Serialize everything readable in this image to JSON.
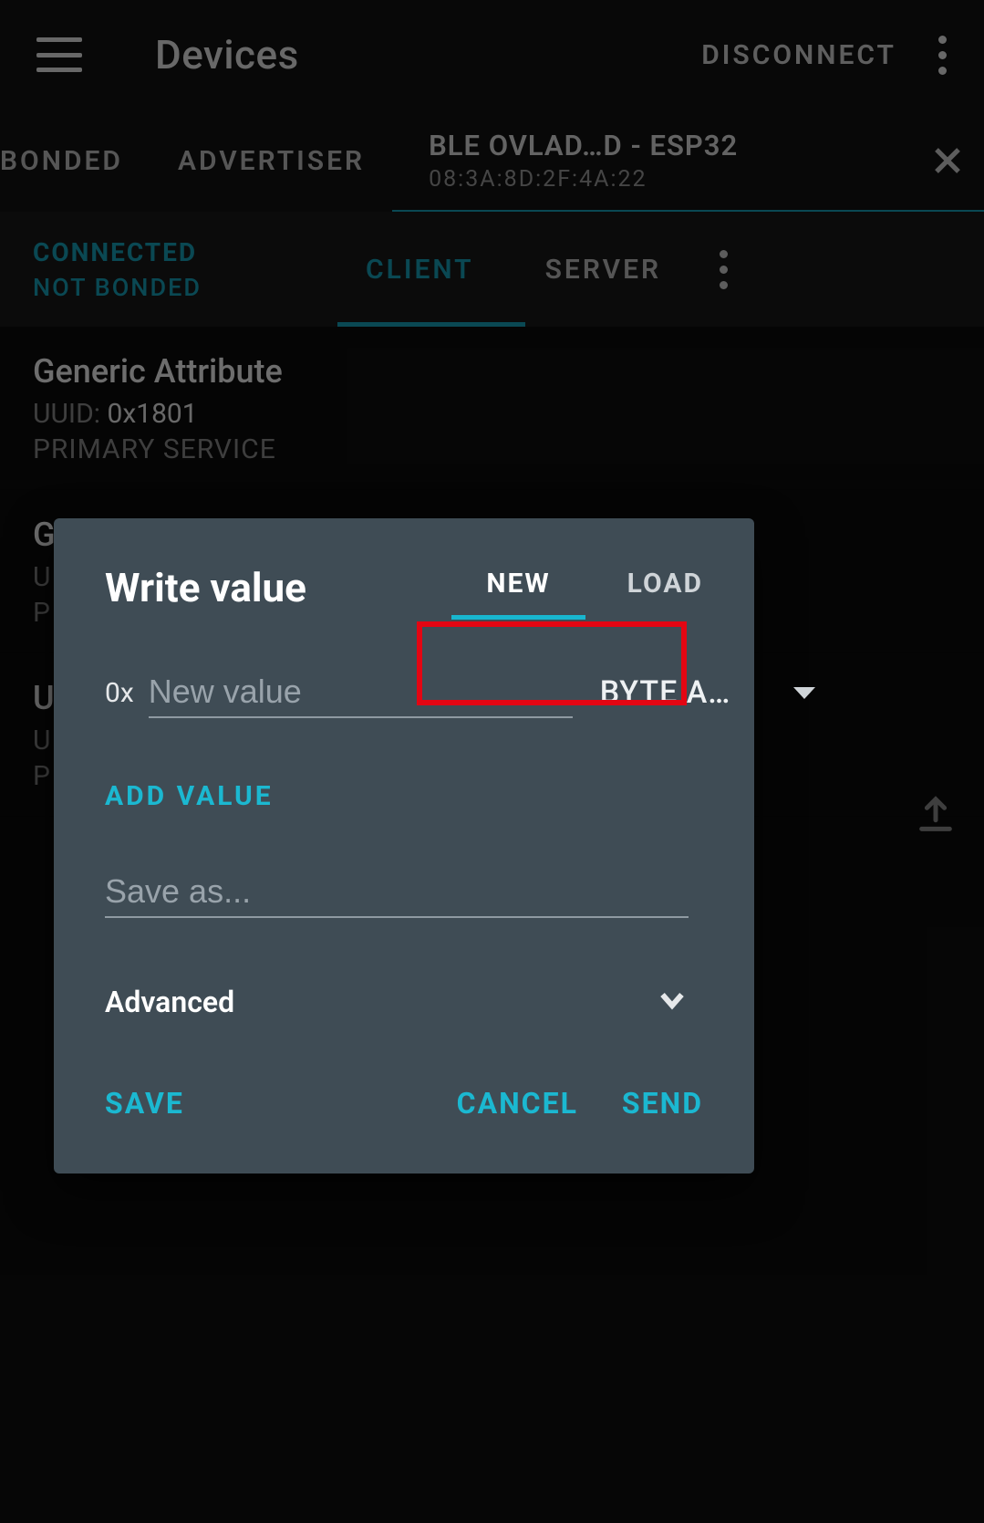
{
  "colors": {
    "accent": "#18b6cf",
    "dialog_bg": "#3f4c55",
    "highlight_border": "#e30613"
  },
  "topbar": {
    "title": "Devices",
    "disconnect_label": "DISCONNECT"
  },
  "tabs": {
    "bonded_label": "BONDED",
    "advertiser_label": "ADVERTISER",
    "device_name": "BLE OVLAD…D - ESP32",
    "device_addr": "08:3A:8D:2F:4A:22"
  },
  "status": {
    "connected_label": "CONNECTED",
    "bonded_label": "NOT BONDED",
    "client_label": "CLIENT",
    "server_label": "SERVER"
  },
  "services": [
    {
      "name": "Generic Attribute",
      "uuid_label": "UUID: ",
      "uuid_value": "0x1801",
      "type": "PRIMARY SERVICE"
    },
    {
      "name": "Generic Access",
      "uuid_label": "U",
      "uuid_value": "",
      "type": "P"
    },
    {
      "name": "U",
      "uuid_label": "U",
      "uuid_value": "",
      "type": "P"
    }
  ],
  "dialog": {
    "title": "Write value",
    "tab_new": "NEW",
    "tab_load": "LOAD",
    "prefix": "0x",
    "value_placeholder": "New value",
    "type_selected": "BYTE A…",
    "add_value_label": "ADD VALUE",
    "save_as_placeholder": "Save as...",
    "advanced_label": "Advanced",
    "save_label": "SAVE",
    "cancel_label": "CANCEL",
    "send_label": "SEND"
  }
}
